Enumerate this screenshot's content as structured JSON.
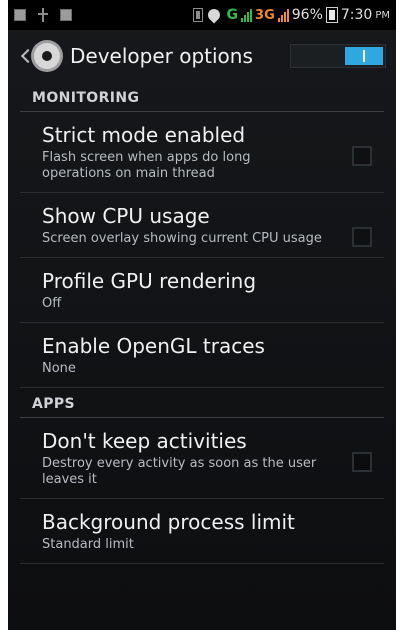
{
  "statusbar": {
    "icons": [
      "notification-icon",
      "usb-icon",
      "sd-icon",
      "vibrate-icon",
      "wifi-icon",
      "signal-icon",
      "signal-icon"
    ],
    "network_g": "G",
    "network_3g": "3G",
    "battery_percent": "96%",
    "time": "7:30",
    "ampm": "PM"
  },
  "appbar": {
    "title": "Developer options",
    "toggle_on": true
  },
  "sections": {
    "monitoring": "MONITORING",
    "apps": "APPS"
  },
  "prefs": {
    "strict_mode": {
      "title": "Strict mode enabled",
      "summary": "Flash screen when apps do long operations on main thread"
    },
    "show_cpu": {
      "title": "Show CPU usage",
      "summary": "Screen overlay showing current CPU usage"
    },
    "profile_gpu": {
      "title": "Profile GPU rendering",
      "summary": "Off"
    },
    "opengl_traces": {
      "title": "Enable OpenGL traces",
      "summary": "None"
    },
    "dont_keep": {
      "title": "Don't keep activities",
      "summary": "Destroy every activity as soon as the user leaves it"
    },
    "bg_limit": {
      "title": "Background process limit",
      "summary": "Standard limit"
    }
  },
  "colors": {
    "accent": "#2fa7e0",
    "signal_green": "#2dbd4d",
    "signal_orange": "#f08a2a"
  }
}
